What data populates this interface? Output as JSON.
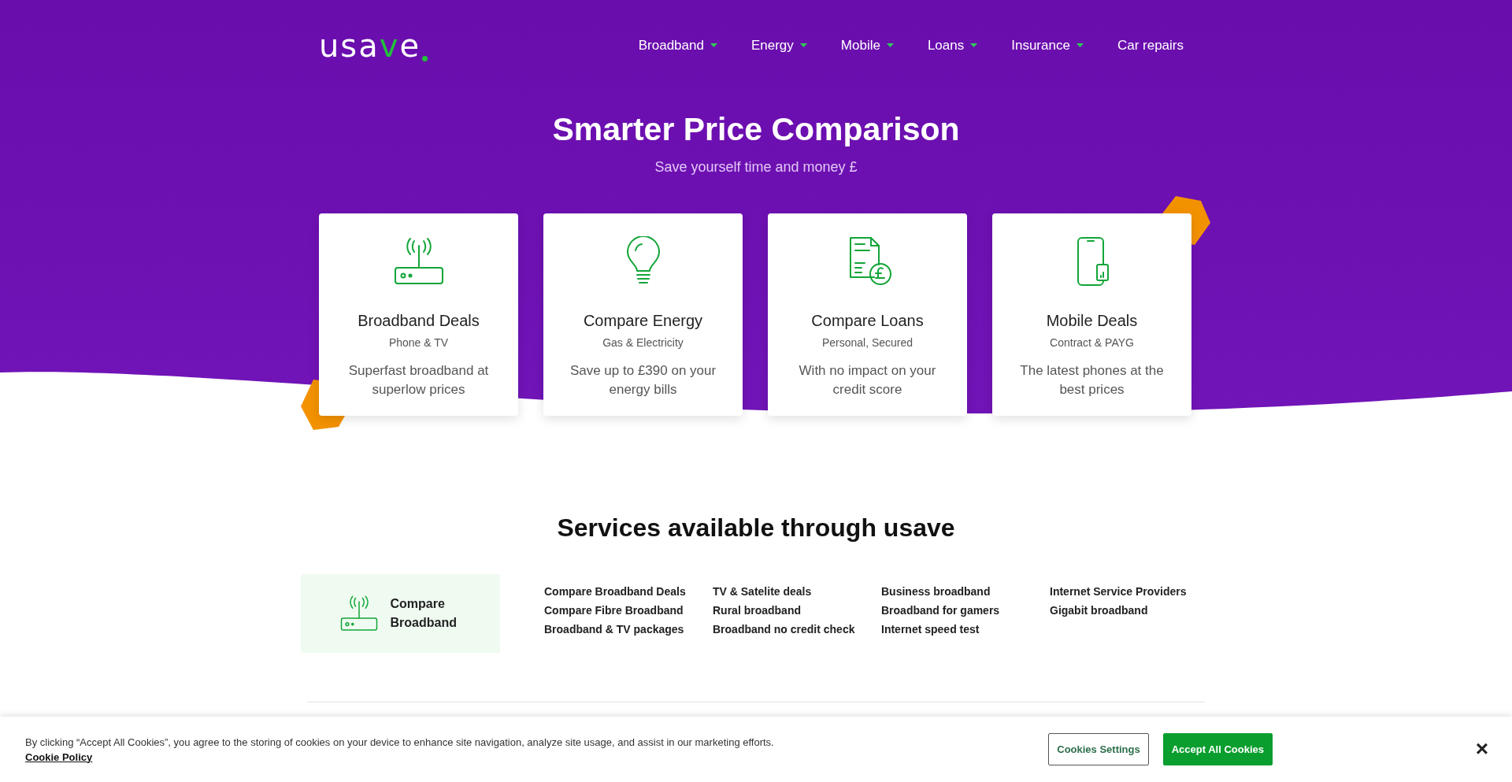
{
  "header": {
    "logo": "usave",
    "nav": [
      {
        "label": "Broadband",
        "has_dropdown": true
      },
      {
        "label": "Energy",
        "has_dropdown": true
      },
      {
        "label": "Mobile",
        "has_dropdown": true
      },
      {
        "label": "Loans",
        "has_dropdown": true
      },
      {
        "label": "Insurance",
        "has_dropdown": true
      },
      {
        "label": "Car repairs",
        "has_dropdown": false
      }
    ]
  },
  "hero": {
    "title": "Smarter Price Comparison",
    "subtitle": "Save yourself time and money £"
  },
  "cards": [
    {
      "kind": "router",
      "title": "Broadband Deals",
      "subtitle": "Phone & TV",
      "text": "Superfast broadband at superlow prices"
    },
    {
      "kind": "bulb",
      "title": "Compare Energy",
      "subtitle": "Gas & Electricity",
      "text": "Save up to £390 on your energy bills"
    },
    {
      "kind": "document",
      "title": "Compare Loans",
      "subtitle": "Personal, Secured",
      "text": "With no impact on your credit score"
    },
    {
      "kind": "phone",
      "title": "Mobile Deals",
      "subtitle": "Contract & PAYG",
      "text": "The latest phones at the best prices"
    }
  ],
  "services": {
    "title": "Services available through usave",
    "categories": [
      {
        "kind": "router",
        "label": "Compare Broadband",
        "selected": true
      }
    ],
    "link_columns": [
      [
        "Compare Broadband Deals",
        "Compare Fibre Broadband",
        "Broadband & TV packages"
      ],
      [
        "TV & Satelite deals",
        "Rural broadband",
        "Broadband no credit check"
      ],
      [
        "Business broadband",
        "Broadband for gamers",
        "Internet speed test"
      ],
      [
        "Internet Service Providers",
        "Gigabit broadband"
      ]
    ]
  },
  "cookie_banner": {
    "text": "By clicking “Accept All Cookies”, you agree to the storing of cookies on your device to enhance site navigation, analyze site usage, and assist in our marketing efforts.",
    "link": "Cookie Policy",
    "buttons": [
      {
        "label": "Cookies Settings",
        "kind": "secondary"
      },
      {
        "label": "Accept All Cookies",
        "kind": "primary"
      }
    ],
    "close": "×"
  }
}
